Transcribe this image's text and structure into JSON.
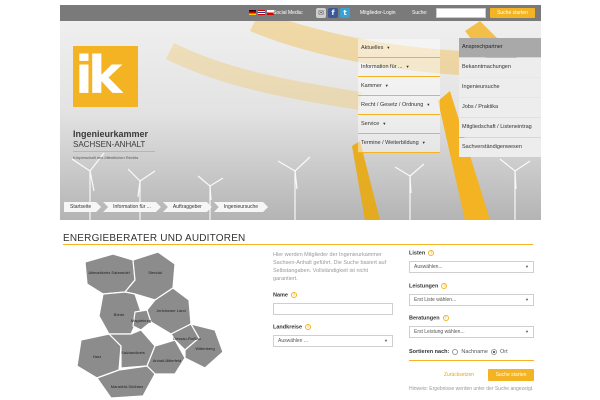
{
  "topbar": {
    "social_label": "Social Media:",
    "member_login": "Mitglieder-Login",
    "search_label": "Suche:",
    "search_button": "Suche starten",
    "search_value": "",
    "icons": [
      "flag-de-icon",
      "flag-en-icon",
      "flag-fr-icon",
      "mail-icon",
      "facebook-icon",
      "twitter-icon"
    ]
  },
  "logo": {
    "letters": "ik",
    "name_line1": "Ingenieurkammer",
    "name_line2": "SACHSEN-ANHALT",
    "tagline": "Körperschaft des öffentlichen Rechts"
  },
  "mainnav": [
    {
      "label": "Aktuelles"
    },
    {
      "label": "Information für ..."
    },
    {
      "label": "Kammer"
    },
    {
      "label": "Recht / Gesetz / Ordnung"
    },
    {
      "label": "Service"
    },
    {
      "label": "Termine / Weiterbildung"
    }
  ],
  "sidenav": [
    {
      "label": "Ansprechpartner"
    },
    {
      "label": "Bekanntmachungen"
    },
    {
      "label": "Ingenieursuche"
    },
    {
      "label": "Jobs / Praktika"
    },
    {
      "label": "Mitgliedschaft / Listeneintrag"
    },
    {
      "label": "Sachverständigenwesen"
    }
  ],
  "breadcrumb": [
    "Startseite",
    "Information für ...",
    "Auftraggeber",
    "Ingenieursuche"
  ],
  "page": {
    "title": "ENERGIEBERATER UND AUDITOREN",
    "intro": "Hier werden Mitglieder der Ingenieurkammer Sachsen-Anhalt geführt. Die Suche basiert auf Selbstangaben. Vollständigkeit ist nicht garantiert."
  },
  "map": {
    "fill": "#8c8c8c",
    "stroke": "#ffffff",
    "labels": [
      "Altmarkkreis Salzwedel",
      "Stendal",
      "Börde",
      "Magdeburg",
      "Jerichower Land",
      "Harz",
      "Salzlandkreis",
      "Anhalt-Bitterfeld",
      "Dessau-Roßlau",
      "Wittenberg",
      "Mansfeld-Südharz"
    ]
  },
  "form": {
    "name_label": "Name",
    "name_value": "",
    "landkreise_label": "Landkreise",
    "landkreise_value": "Auswählen ...",
    "listen_label": "Listen",
    "listen_value": "Auswählen...",
    "leistungen_label": "Leistungen",
    "leistungen_value": "Erst Liste wählen...",
    "beratungen_label": "Beratungen",
    "beratungen_value": "Erst Leistung wählen...",
    "sort_label": "Sortieren nach:",
    "sort_option1": "Nachname",
    "sort_option2": "Ort",
    "sort_selected": "Ort",
    "reset_label": "Zurücksetzen",
    "start_label": "Suche starten",
    "hint": "Hinweis: Ergebnisse werden unter der Suche angezeigt."
  },
  "colors": {
    "accent": "#f3b322",
    "topbar": "#7a7a7a",
    "sidenav_active": "#a9a9a9"
  }
}
